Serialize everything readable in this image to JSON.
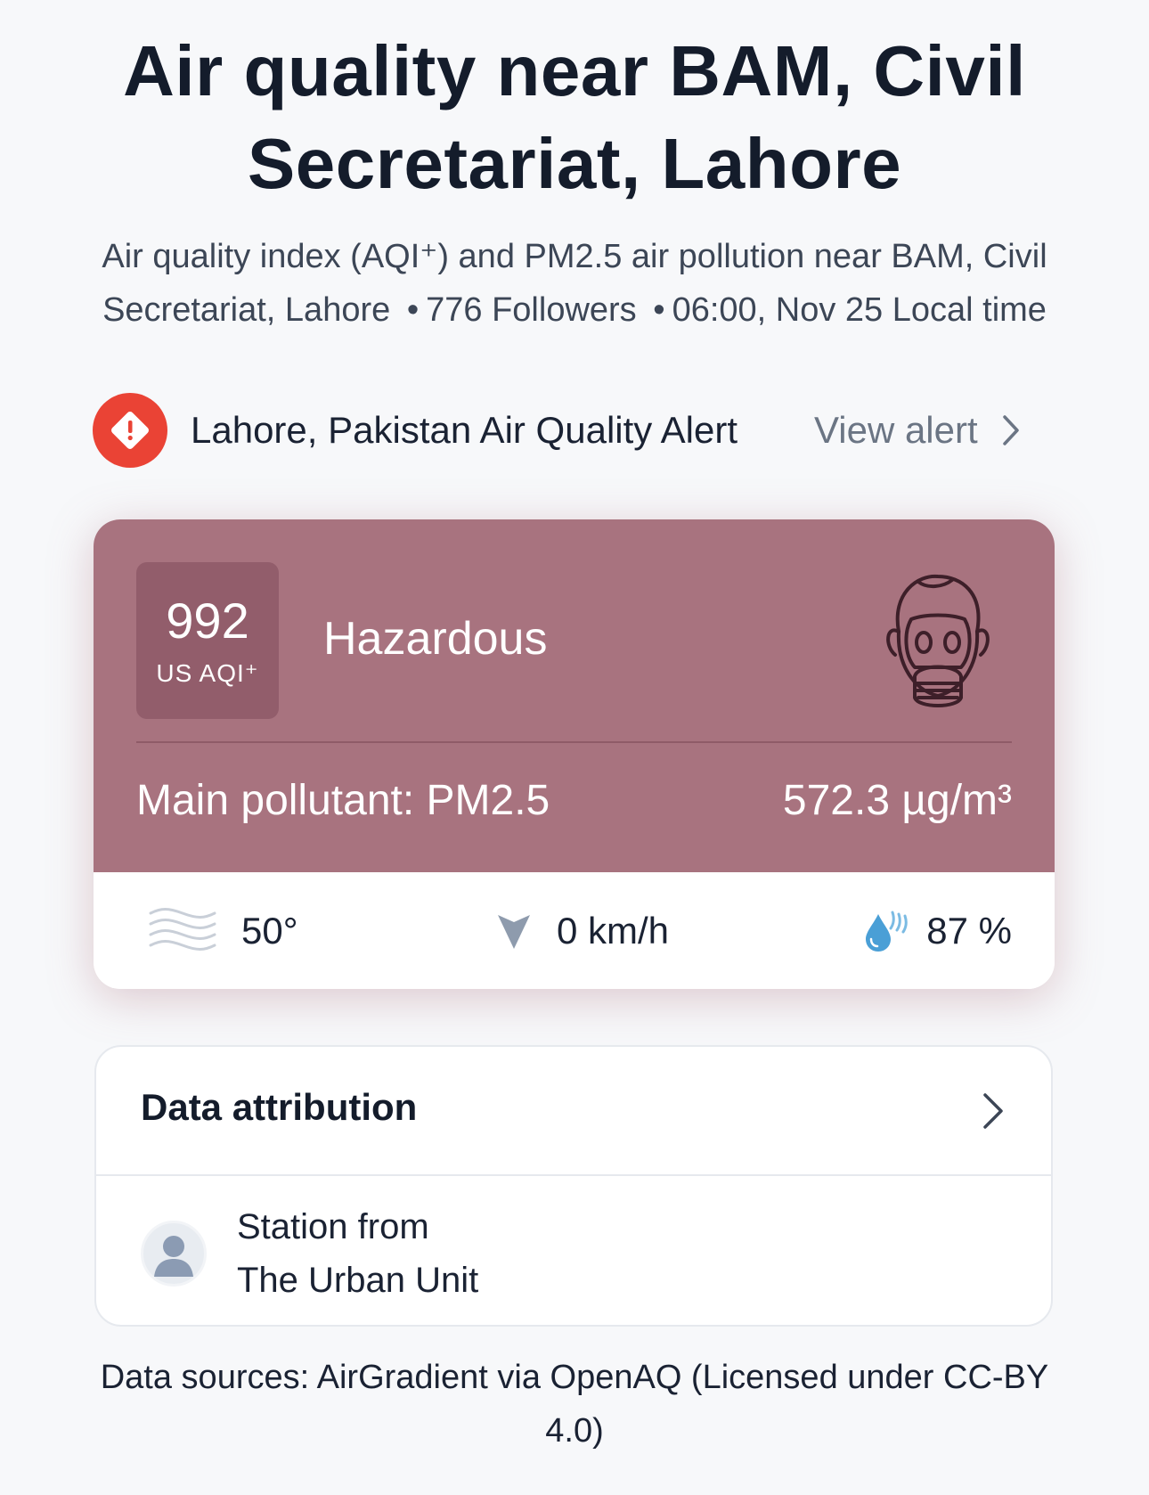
{
  "header": {
    "title": "Air quality near BAM, Civil Secretariat, Lahore",
    "subtitle_desc": "Air quality index (AQI⁺) and PM2.5 air pollution near BAM, Civil Secretariat, Lahore",
    "subtitle_followers": "776 Followers",
    "subtitle_time": "06:00, Nov 25 Local time",
    "separator": "•"
  },
  "alert": {
    "icon": "alert-diamond-icon",
    "text": "Lahore, Pakistan Air Quality Alert",
    "link_label": "View alert",
    "color": "#ea4335"
  },
  "aqi": {
    "value": "992",
    "unit": "US AQI⁺",
    "status": "Hazardous",
    "status_icon": "gas-mask-icon",
    "color": "#a8737f",
    "main_pollutant_label": "Main pollutant: PM2.5",
    "pollutant_value": "572.3 µg/m³"
  },
  "weather": {
    "temperature": "50°",
    "temperature_icon": "fog-icon",
    "wind": "0 km/h",
    "wind_icon": "wind-direction-icon",
    "humidity": "87 %",
    "humidity_icon": "humidity-icon"
  },
  "attribution": {
    "title": "Data attribution",
    "station_line1": "Station from",
    "station_line2": "The Urban Unit"
  },
  "footer": {
    "sources": "Data sources: AirGradient via OpenAQ (Licensed under CC-BY 4.0)"
  }
}
